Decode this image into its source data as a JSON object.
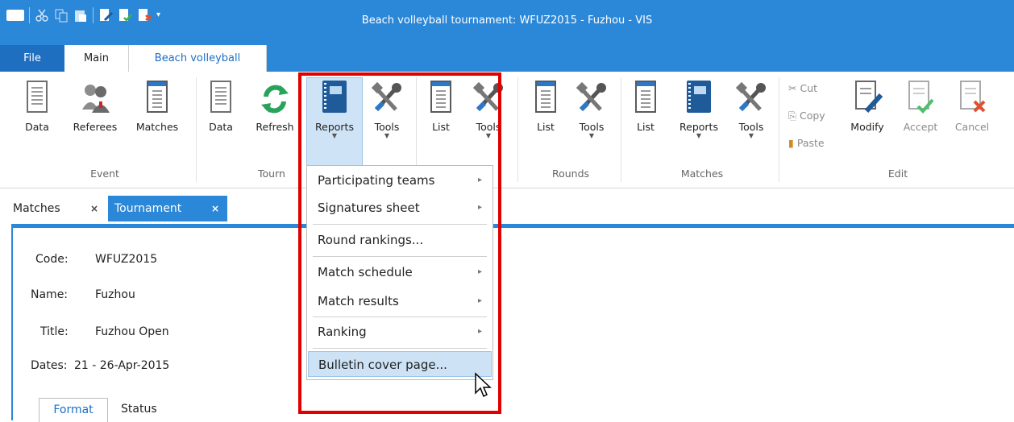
{
  "window": {
    "title": "Beach volleyball tournament: WFUZ2015 - Fuzhou - VIS"
  },
  "quick_access": [
    "app-logo-icon",
    "cut-icon",
    "copy-icon",
    "paste-icon",
    "modify-icon",
    "accept-icon",
    "cancel-icon",
    "customize-dropdown-icon"
  ],
  "ribbon_tabs": [
    "File",
    "Main",
    "Beach volleyball"
  ],
  "ribbon": {
    "event": {
      "label": "Event",
      "buttons": [
        "Data",
        "Referees",
        "Matches"
      ]
    },
    "tournament": {
      "label": "Tourn",
      "buttons": [
        "Data",
        "Refresh",
        "Reports",
        "Tools"
      ]
    },
    "group3": {
      "buttons": [
        "List",
        "Tools"
      ]
    },
    "rounds": {
      "label": "Rounds",
      "buttons": [
        "List",
        "Tools"
      ]
    },
    "matches": {
      "label": "Matches",
      "buttons": [
        "List",
        "Reports",
        "Tools"
      ]
    },
    "edit": {
      "label": "Edit",
      "small": [
        "Cut",
        "Copy",
        "Paste"
      ],
      "buttons": [
        "Modify",
        "Accept",
        "Cancel"
      ]
    }
  },
  "doc_tabs": {
    "matches": "Matches",
    "tournament": "Tournament",
    "close": "×"
  },
  "form": {
    "code_label": "Code:",
    "code_value": "WFUZ2015",
    "name_label": "Name:",
    "name_value": "Fuzhou",
    "title_label": "Title:",
    "title_value": "Fuzhou Open",
    "dates_label": "Dates:",
    "dates_value": "21 - 26-Apr-2015"
  },
  "sub_tabs": {
    "format": "Format",
    "status": "Status"
  },
  "menu": {
    "items": [
      "Participating teams",
      "Signatures sheet",
      "Round rankings...",
      "Match schedule",
      "Match results",
      "Ranking",
      "Bulletin cover page..."
    ],
    "submenu_arrow": "▸"
  },
  "colors": {
    "accent": "#2b87d8",
    "highlight_box": "#e00000",
    "menu_hover": "#cde3f5"
  }
}
